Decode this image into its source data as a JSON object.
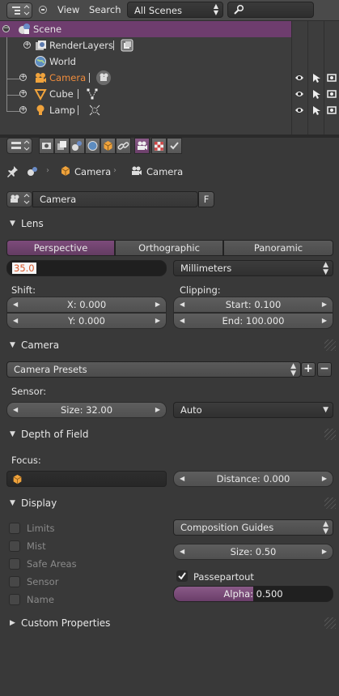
{
  "outliner": {
    "menus": [
      "View",
      "Search"
    ],
    "scenes_select": "All Scenes",
    "search": {
      "placeholder": ""
    },
    "rows": [
      {
        "name": "Scene"
      },
      {
        "name": "RenderLayers"
      },
      {
        "name": "World"
      },
      {
        "name": "Camera"
      },
      {
        "name": "Cube"
      },
      {
        "name": "Lamp"
      }
    ]
  },
  "properties": {
    "breadcrumb": [
      "Camera",
      "Camera"
    ],
    "datablock": {
      "name": "Camera",
      "fake_user": "F"
    },
    "lens": {
      "title": "Lens",
      "types": [
        "Perspective",
        "Orthographic",
        "Panoramic"
      ],
      "active_type": "Perspective",
      "focal_length": "35.0",
      "unit": "Millimeters",
      "shift_label": "Shift:",
      "shift_x": "X: 0.000",
      "shift_y": "Y: 0.000",
      "clipping_label": "Clipping:",
      "clip_start": "Start: 0.100",
      "clip_end": "End: 100.000"
    },
    "camera": {
      "title": "Camera",
      "presets": "Camera Presets",
      "sensor_label": "Sensor:",
      "sensor_size": "Size: 32.00",
      "sensor_fit": "Auto"
    },
    "dof": {
      "title": "Depth of Field",
      "focus_label": "Focus:",
      "distance": "Distance: 0.000"
    },
    "display": {
      "title": "Display",
      "checks": [
        {
          "label": "Limits",
          "checked": false
        },
        {
          "label": "Mist",
          "checked": false
        },
        {
          "label": "Safe Areas",
          "checked": false
        },
        {
          "label": "Sensor",
          "checked": false
        },
        {
          "label": "Name",
          "checked": false
        }
      ],
      "guides": "Composition Guides",
      "size": "Size: 0.50",
      "passepartout": {
        "label": "Passepartout",
        "checked": true
      },
      "alpha": "Alpha: 0.500",
      "alpha_value": 0.5
    },
    "custom": {
      "title": "Custom Properties"
    }
  },
  "colors": {
    "selected_row": "#6e3d6e",
    "active_object_text": "#f08c3c",
    "accent": "#8a5b88"
  }
}
